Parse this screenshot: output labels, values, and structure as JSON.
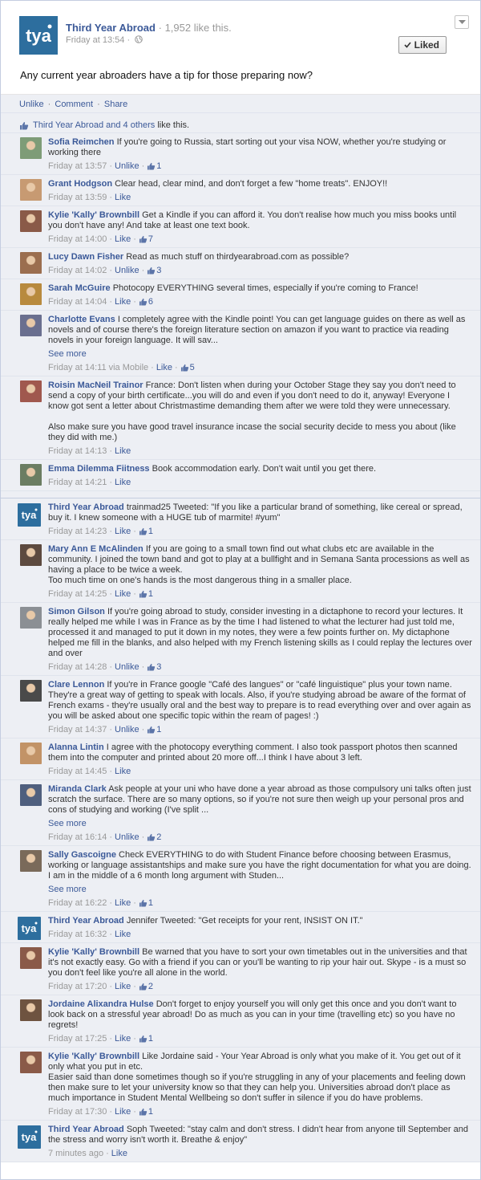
{
  "post": {
    "page_name": "Third Year Abroad",
    "like_count_text": "1,952 like this.",
    "time": "Friday at 13:54",
    "liked_label": "Liked",
    "message": "Any current year abroaders have a tip for those preparing now?",
    "logo_text": "tya"
  },
  "actions": {
    "unlike": "Unlike",
    "comment": "Comment",
    "share": "Share"
  },
  "likes_summary": {
    "prefix": "Third Year Abroad and",
    "others": "4 others",
    "suffix": "like this."
  },
  "colors": {
    "brand": "#3b5998",
    "logo_bg": "#2d6e9e",
    "panel": "#edeff4"
  },
  "comments": [
    {
      "author": "Sofia Reimchen",
      "text": "If you're going to Russia, start sorting out your visa NOW, whether you're studying or working there",
      "time": "Friday at 13:57",
      "action": "Unlike",
      "likes": "1",
      "avatar": "#7e9c77"
    },
    {
      "author": "Grant Hodgson",
      "text": "Clear head, clear mind, and don't forget a few \"home treats\". ENJOY!!",
      "time": "Friday at 13:59",
      "action": "Like",
      "likes": "",
      "avatar": "#c79a72"
    },
    {
      "author": "Kylie 'Kally' Brownbill",
      "text": "Get a Kindle if you can afford it. You don't realise how much you miss books until you don't have any! And take at least one text book.",
      "time": "Friday at 14:00",
      "action": "Like",
      "likes": "7",
      "avatar": "#8a5a48"
    },
    {
      "author": "Lucy Dawn Fisher",
      "text": "Read as much stuff on thirdyearabroad.com as possible?",
      "time": "Friday at 14:02",
      "action": "Unlike",
      "likes": "3",
      "avatar": "#9b6e4f"
    },
    {
      "author": "Sarah McGuire",
      "text": "Photocopy EVERYTHING several times, especially if you're coming to France!",
      "time": "Friday at 14:04",
      "action": "Like",
      "likes": "6",
      "avatar": "#b88a3e"
    },
    {
      "author": "Charlotte Evans",
      "text": "I completely agree with the Kindle point! You can get language guides on there as well as novels and of course there's the foreign literature section on amazon if you want to practice via reading novels in your foreign language. It will sav...",
      "more": "See more",
      "time": "Friday at 14:11 via Mobile",
      "action": "Like",
      "likes": "5",
      "avatar": "#6a6f8f"
    },
    {
      "author": "Roisin MacNeil Trainor",
      "text": "France: Don't listen when during your October Stage they say you don't need to send a copy of your birth certificate...you will do and even if you don't need to do it, anyway! Everyone I know got sent a letter about Christmastime demanding them after we were told they were unnecessary.",
      "text2": "Also make sure you have good travel insurance incase the social security decide to mess you about (like they did with me.)",
      "time": "Friday at 14:13",
      "action": "Like",
      "likes": "",
      "avatar": "#a0584e"
    },
    {
      "author": "Emma Dilemma Fiitness",
      "text": "Book accommodation early. Don't wait until you get there.",
      "time": "Friday at 14:21",
      "action": "Like",
      "likes": "",
      "avatar": "#6b7d62"
    },
    {
      "author": "Third Year Abroad",
      "text": "trainmad25 Tweeted: \"If you like a particular brand of something, like cereal or spread, buy it. I knew someone with a HUGE tub of marmite! #yum\"",
      "time": "Friday at 14:23",
      "action": "Like",
      "likes": "1",
      "avatar": "tya"
    },
    {
      "author": "Mary Ann E McAlinden",
      "text": "If you are going to a small town find out what clubs etc are available in the community. I joined the town band and got to play at a bullfight and in Semana Santa processions as well as having a place to be twice a week.",
      "text_line": "Too much time on one's hands is the most dangerous thing in a smaller place.",
      "time": "Friday at 14:25",
      "action": "Like",
      "likes": "1",
      "avatar": "#5d4a3f"
    },
    {
      "author": "Simon Gilson",
      "text": "If you're going abroad to study, consider investing in a dictaphone to record your lectures. It really helped me while I was in France as by the time I had listened to what the lecturer had just told me, processed it and managed to put it down in my notes, they were a few points further on. My dictaphone helped me fill in the blanks, and also helped with my French listening skills as I could replay the lectures over and over",
      "time": "Friday at 14:28",
      "action": "Unlike",
      "likes": "3",
      "avatar": "#8b8f94"
    },
    {
      "author": "Clare Lennon",
      "text": "If you're in France google \"Café des langues\" or \"café linguistique\" plus your town name. They're a great way of getting to speak with locals. Also, if you're studying abroad be aware of the format of French exams - they're usually oral and the best way to prepare is to read everything over and over again as you will be asked about one specific topic within the ream of pages! :)",
      "time": "Friday at 14:37",
      "action": "Unlike",
      "likes": "1",
      "avatar": "#4a4a4a"
    },
    {
      "author": "Alanna Lintin",
      "text": "I agree with the photocopy everything comment. I also took passport photos then scanned them into the computer and printed about 20 more off...I think I have about 3 left.",
      "time": "Friday at 14:45",
      "action": "Like",
      "likes": "",
      "avatar": "#c29367"
    },
    {
      "author": "Miranda Clark",
      "text": "Ask people at your uni who have done a year abroad as those compulsory uni talks often just scratch the surface. There are so many options, so if you're not sure then weigh up your personal pros and cons of studying and working (I've split ...",
      "more": "See more",
      "time": "Friday at 16:14",
      "action": "Unlike",
      "likes": "2",
      "avatar": "#4f5f7e"
    },
    {
      "author": "Sally Gascoigne",
      "text": "Check EVERYTHING to do with Student Finance before choosing between Erasmus, working or language assistantships and make sure you have the right documentation for what you are doing. I am in the middle of a 6 month long argument with Studen...",
      "more": "See more",
      "time": "Friday at 16:22",
      "action": "Like",
      "likes": "1",
      "avatar": "#7a6a5a"
    },
    {
      "author": "Third Year Abroad",
      "text": "Jennifer Tweeted: \"Get receipts for your rent, INSIST ON IT.\"",
      "time": "Friday at 16:32",
      "action": "Like",
      "likes": "",
      "avatar": "tya"
    },
    {
      "author": "Kylie 'Kally' Brownbill",
      "text": "Be warned that you have to sort your own timetables out in the universities and that it's not exactly easy. Go with a friend if you can or you'll be wanting to rip your hair out. Skype - is a must so you don't feel like you're all alone in the world.",
      "time": "Friday at 17:20",
      "action": "Like",
      "likes": "2",
      "avatar": "#8a5a48"
    },
    {
      "author": "Jordaine Alixandra Hulse",
      "text": "Don't forget to enjoy yourself you will only get this once and you don't want to look back on a stressful year abroad! Do as much as you can in your time (travelling etc) so you have no regrets!",
      "time": "Friday at 17:25",
      "action": "Like",
      "likes": "1",
      "avatar": "#6e5340"
    },
    {
      "author": "Kylie 'Kally' Brownbill",
      "text": "Like Jordaine said - Your Year Abroad is only what you make of it. You get out of it only what you put in etc.",
      "text_line": "Easier said than done sometimes though so if you're struggling in any of your placements and feeling down then make sure to let your university know so that they can help you. Universities abroad don't place as much importance in Student Mental Wellbeing so don't suffer in silence if you do have problems.",
      "time": "Friday at 17:30",
      "action": "Like",
      "likes": "1",
      "avatar": "#8a5a48"
    },
    {
      "author": "Third Year Abroad",
      "text": "Soph Tweeted: \"stay calm and don't stress. I didn't hear from anyone till September and the stress and worry isn't worth it. Breathe & enjoy\"",
      "time": "7 minutes ago",
      "action": "Like",
      "likes": "",
      "avatar": "tya"
    }
  ]
}
